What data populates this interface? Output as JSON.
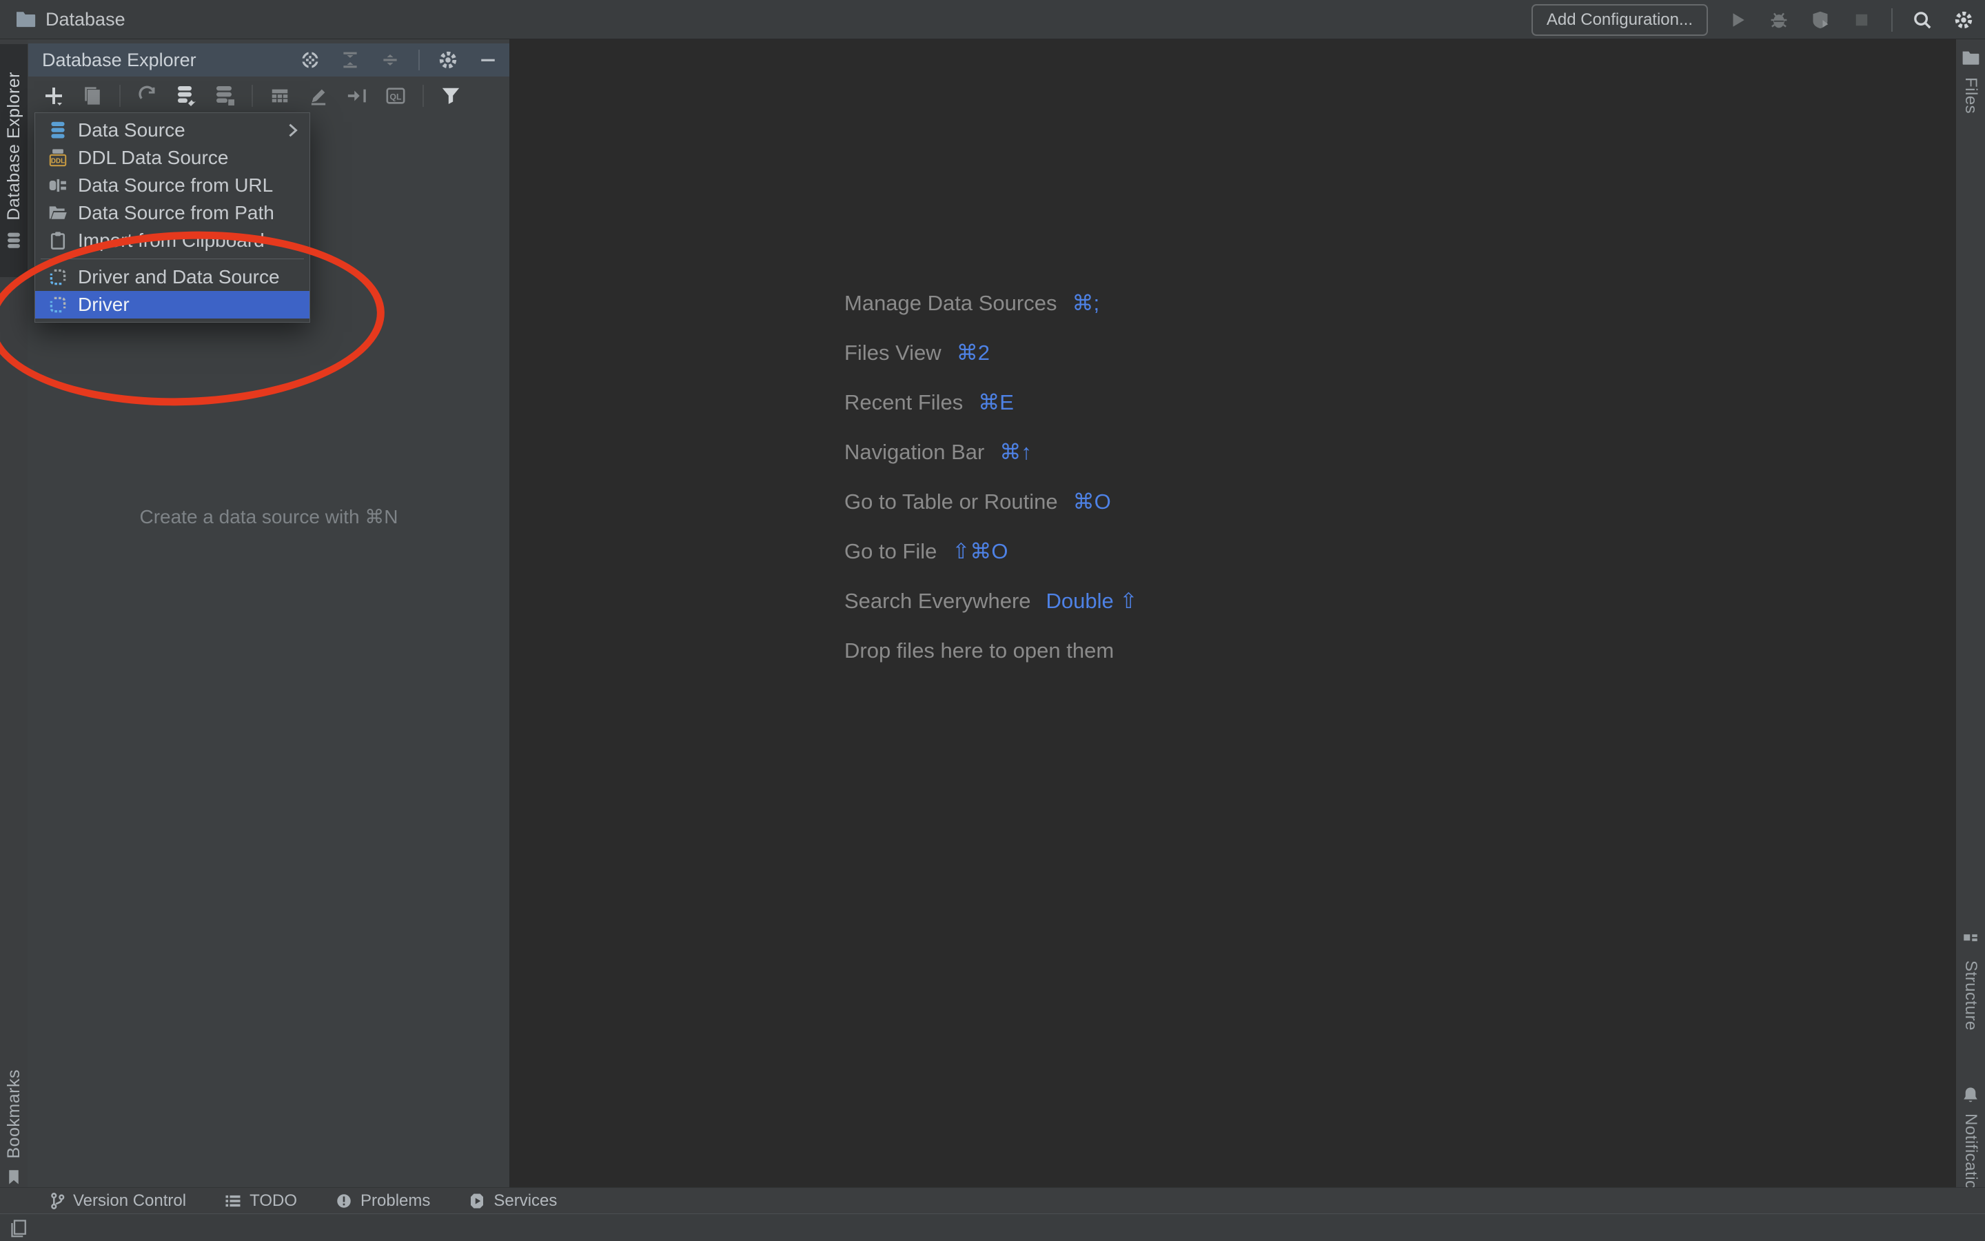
{
  "titlebar": {
    "project": "Database",
    "add_configuration": "Add Configuration..."
  },
  "left_stripe": {
    "explorer_tab": "Database Explorer",
    "bookmarks_tab": "Bookmarks"
  },
  "right_stripe": {
    "files_tab": "Files",
    "structure_tab": "Structure",
    "notifications_tab": "Notifications"
  },
  "explorer_panel": {
    "header_title": "Database Explorer",
    "empty_hint": "Create a data source with ⌘N"
  },
  "menu": {
    "items": [
      {
        "label": "Data Source",
        "icon": "database-icon",
        "has_submenu": true
      },
      {
        "label": "DDL Data Source",
        "icon": "ddl-file-icon"
      },
      {
        "label": "Data Source from URL",
        "icon": "plug-icon"
      },
      {
        "label": "Data Source from Path",
        "icon": "open-folder-icon"
      },
      {
        "label": "Import from Clipboard",
        "icon": "clipboard-icon"
      },
      {
        "label": "Driver and Data Source",
        "icon": "driver-icon"
      },
      {
        "label": "Driver",
        "icon": "driver-icon",
        "selected": true
      }
    ]
  },
  "shortcuts": [
    {
      "label": "Manage Data Sources",
      "keys": "⌘;"
    },
    {
      "label": "Files View",
      "keys": "⌘2"
    },
    {
      "label": "Recent Files",
      "keys": "⌘E"
    },
    {
      "label": "Navigation Bar",
      "keys": "⌘↑"
    },
    {
      "label": "Go to Table or Routine",
      "keys": "⌘O"
    },
    {
      "label": "Go to File",
      "keys": "⇧⌘O"
    },
    {
      "label": "Search Everywhere",
      "keys": "Double ⇧"
    },
    {
      "label": "Drop files here to open them",
      "keys": ""
    }
  ],
  "bottom_bar": {
    "version_control": "Version Control",
    "todo": "TODO",
    "problems": "Problems",
    "services": "Services"
  },
  "colors": {
    "selection_blue": "#3d63c6",
    "shortcut_blue": "#4e82e6",
    "annotation_red": "#e6391d",
    "panel_bg": "#3d4042",
    "editor_bg": "#2b2b2b",
    "header_bg": "#424c57",
    "datasource_icon_blue": "#5a9fd4",
    "driver_icon_blue": "#64b1e8",
    "ddl_gold": "#d9a94a"
  }
}
